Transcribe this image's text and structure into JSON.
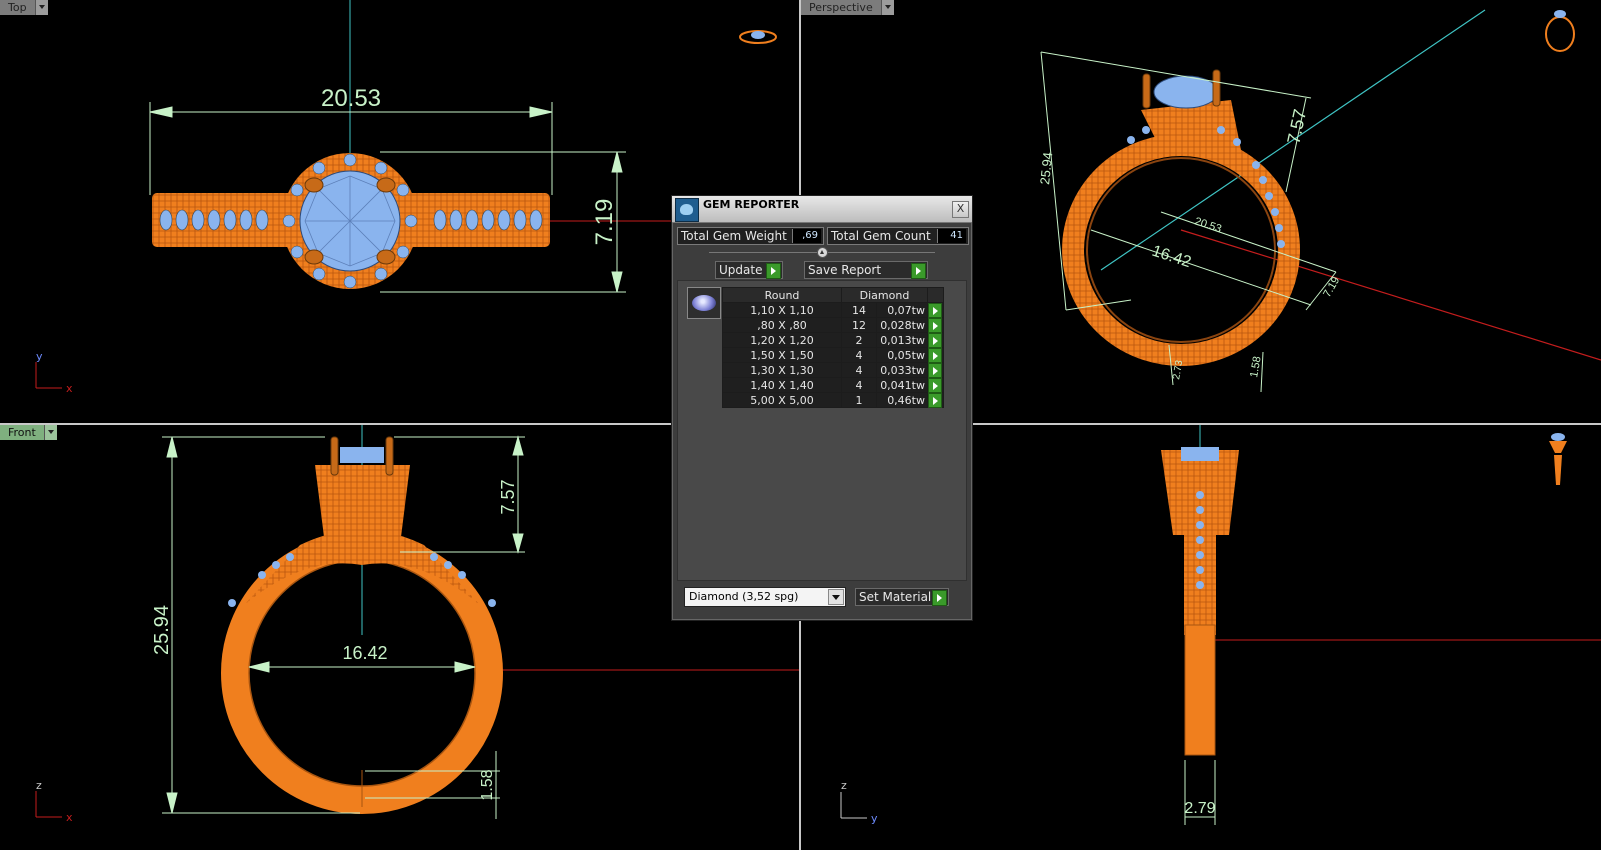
{
  "viewports": {
    "top": {
      "label": "Top",
      "axis_a": "y",
      "axis_b": "x",
      "dim_width": "20.53",
      "dim_height": "7.19"
    },
    "perspective": {
      "label": "Perspective",
      "dim_height": "25.94",
      "dim_top": "7.57",
      "dim_inner": "16.42",
      "dim_width": "20.53",
      "dim_band": "7.19",
      "dim_shank": "2.73",
      "dim_base": "1.58"
    },
    "front": {
      "label": "Front",
      "axis_a": "z",
      "axis_b": "x",
      "dim_height": "25.94",
      "dim_top": "7.57",
      "dim_inner": "16.42",
      "dim_base": "1.58"
    },
    "right": {
      "axis_a": "z",
      "axis_b": "y",
      "dim_width": "2.79"
    }
  },
  "gem_reporter": {
    "title": "GEM REPORTER",
    "close": "X",
    "total_weight_label": "Total Gem Weight",
    "total_weight_value": ",69",
    "total_count_label": "Total Gem Count",
    "total_count_value": "41",
    "update_label": "Update",
    "save_report_label": "Save Report",
    "columns": {
      "shape": "Round",
      "material": "Diamond"
    },
    "rows": [
      {
        "size": "1,10 X 1,10",
        "count": "14",
        "weight": "0,07tw"
      },
      {
        "size": ",80 X ,80",
        "count": "12",
        "weight": "0,028tw"
      },
      {
        "size": "1,20 X 1,20",
        "count": "2",
        "weight": "0,013tw"
      },
      {
        "size": "1,50 X 1,50",
        "count": "4",
        "weight": "0,05tw"
      },
      {
        "size": "1,30 X 1,30",
        "count": "4",
        "weight": "0,033tw"
      },
      {
        "size": "1,40 X 1,40",
        "count": "4",
        "weight": "0,041tw"
      },
      {
        "size": "5,00 X 5,00",
        "count": "1",
        "weight": "0,46tw"
      }
    ],
    "material_select": "Diamond    (3,52 spg)",
    "set_material_label": "Set Material"
  },
  "colors": {
    "metal": "#f07f1e",
    "gem": "#8ab4ee",
    "dim": "#c8f2c8",
    "axis_cyan": "#3fc4c4",
    "axis_red": "#c41d1d"
  }
}
